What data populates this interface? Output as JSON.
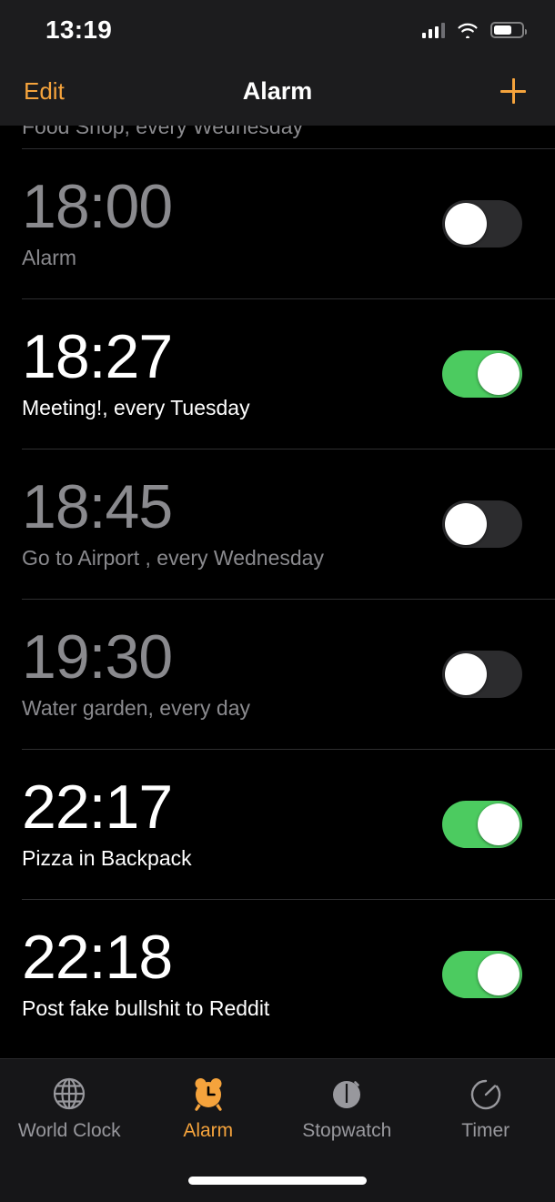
{
  "status_bar": {
    "time": "13:19",
    "signal_icon": "cellular-bars-icon",
    "wifi_icon": "wifi-icon",
    "battery_icon": "battery-icon",
    "battery_level_percent": 65
  },
  "nav_bar": {
    "edit_label": "Edit",
    "title": "Alarm",
    "add_icon": "plus-icon"
  },
  "colors": {
    "accent": "#f5a33c",
    "toggle_on": "#4ccb60",
    "toggle_off": "#2c2c2e",
    "disabled_text": "#8a8a8e",
    "enabled_text": "#ffffff",
    "background": "#000000",
    "bar_background": "#1c1c1e",
    "separator": "#2e2e30"
  },
  "alarms": [
    {
      "time": "",
      "hours": "",
      "minutes": "",
      "label": "Food Shop, every Wednesday",
      "enabled": false,
      "partial": true
    },
    {
      "time": "18:00",
      "hours": "18",
      "minutes": "00",
      "label": "Alarm",
      "enabled": false,
      "partial": false
    },
    {
      "time": "18:27",
      "hours": "18",
      "minutes": "27",
      "label": "Meeting!, every Tuesday",
      "enabled": true,
      "partial": false
    },
    {
      "time": "18:45",
      "hours": "18",
      "minutes": "45",
      "label": "Go to Airport , every Wednesday",
      "enabled": false,
      "partial": false
    },
    {
      "time": "19:30",
      "hours": "19",
      "minutes": "30",
      "label": "Water garden, every day",
      "enabled": false,
      "partial": false
    },
    {
      "time": "22:17",
      "hours": "22",
      "minutes": "17",
      "label": "Pizza in Backpack",
      "enabled": true,
      "partial": false
    },
    {
      "time": "22:18",
      "hours": "22",
      "minutes": "18",
      "label": "Post fake bullshit to Reddit",
      "enabled": true,
      "partial": false
    }
  ],
  "tab_bar": {
    "tabs": [
      {
        "label": "World Clock",
        "icon": "globe-icon",
        "active": false
      },
      {
        "label": "Alarm",
        "icon": "alarm-clock-icon",
        "active": true
      },
      {
        "label": "Stopwatch",
        "icon": "stopwatch-icon",
        "active": false
      },
      {
        "label": "Timer",
        "icon": "timer-icon",
        "active": false
      }
    ]
  },
  "home_indicator": "home-indicator"
}
